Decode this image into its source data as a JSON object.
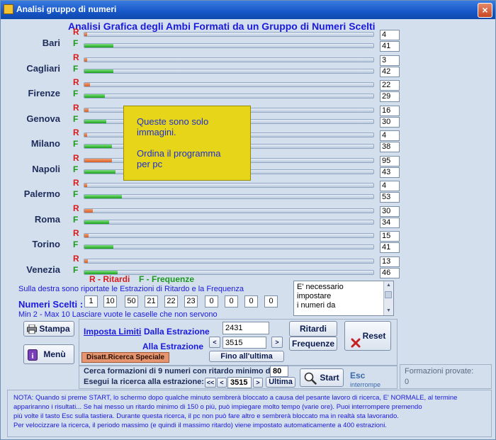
{
  "window": {
    "title": "Analisi gruppo di numeri",
    "close_label": "×"
  },
  "heading": "Analisi Grafica degli Ambi Formati da un Gruppo di Numeri Scelti",
  "row_labels": {
    "r": "R",
    "f": "F"
  },
  "cities": [
    {
      "name": "Bari",
      "ritardo": "4",
      "frequenza": "41",
      "r_pct": 0.004,
      "f_pct": 0.1
    },
    {
      "name": "Cagliari",
      "ritardo": "3",
      "frequenza": "42",
      "r_pct": 0.003,
      "f_pct": 0.1
    },
    {
      "name": "Firenze",
      "ritardo": "22",
      "frequenza": "29",
      "r_pct": 0.02,
      "f_pct": 0.07
    },
    {
      "name": "Genova",
      "ritardo": "16",
      "frequenza": "30",
      "r_pct": 0.015,
      "f_pct": 0.075
    },
    {
      "name": "Milano",
      "ritardo": "4",
      "frequenza": "38",
      "r_pct": 0.004,
      "f_pct": 0.095
    },
    {
      "name": "Napoli",
      "ritardo": "95",
      "frequenza": "43",
      "r_pct": 0.095,
      "f_pct": 0.107
    },
    {
      "name": "Palermo",
      "ritardo": "4",
      "frequenza": "53",
      "r_pct": 0.004,
      "f_pct": 0.13
    },
    {
      "name": "Roma",
      "ritardo": "30",
      "frequenza": "34",
      "r_pct": 0.03,
      "f_pct": 0.085
    },
    {
      "name": "Torino",
      "ritardo": "15",
      "frequenza": "41",
      "r_pct": 0.015,
      "f_pct": 0.1
    },
    {
      "name": "Venezia",
      "ritardo": "13",
      "frequenza": "46",
      "r_pct": 0.013,
      "f_pct": 0.115
    }
  ],
  "legend": {
    "ritardi": "R - Ritardi",
    "frequenze": "F - Frequenze"
  },
  "info_line": "Sulla destra sono riportate le Estrazioni di Ritardo e la Frequenza",
  "memo": {
    "lines": [
      "E' necessario",
      "impostare",
      "i numeri da"
    ]
  },
  "numeri_scelti": {
    "label": "Numeri Scelti :",
    "values": [
      "1",
      "10",
      "50",
      "21",
      "22",
      "23",
      "0",
      "0",
      "0",
      "0"
    ]
  },
  "minmax_hint": "Min 2 - Max 10 Lasciare vuote le caselle che non servono",
  "buttons": {
    "stampa": "Stampa",
    "menu": "Menù",
    "ritardi": "Ritardi",
    "frequenze": "Frequenze",
    "reset": "Reset",
    "fino_ultima": "Fino all'ultima",
    "start": "Start",
    "ultima": "Ultima"
  },
  "limiti": {
    "imposta_link": "Imposta Limiti",
    "dalla_label": "Dalla Estrazione",
    "dalla_value": "2431",
    "alla_label": "Alla Estrazione",
    "alla_value": "3515",
    "prev_label": "<",
    "next_label": ">"
  },
  "disatt_label": "Disatt.Ricerca Speciale",
  "cerca": {
    "label": "Cerca formazioni di 9 numeri con  ritardo minimo di:",
    "ritardo_value": "80",
    "esegui_label": "Esegui la ricerca alla estrazione:",
    "estrazione_value": "3515",
    "first_label": "<<",
    "prev_label": "<",
    "next_label": ">"
  },
  "esc": {
    "title": "Esc",
    "subtitle": "interrompe"
  },
  "formazioni": {
    "label": "Formazioni provate:",
    "value": "0"
  },
  "notes": [
    "NOTA: Quando si preme START, lo schermo dopo qualche minuto  sembrerà  bloccato a causa del pesante lavoro di ricerca, E' NORMALE, al termine",
    "appariranno  i risultati...    Se hai messo un ritardo minimo di 150 o più, può impiegare molto tempo (varie ore). Puoi interrompere premendo",
    "più volte il tasto Esc sulla tastiera.        Durante questa ricerca, il pc non può fare altro e sembrerà bloccato ma in realtà sta lavorando.",
    "Per velocizzare la ricerca, il periodo massimo (e quindi il massimo ritardo) viene impostato automaticamente a 400 estrazioni."
  ],
  "overlay": {
    "line1": "Queste sono solo",
    "line2": "immagini.",
    "line3": "Ordina il programma",
    "line4": "per pc"
  },
  "colors": {
    "title_bar": "#1656c8",
    "ritardo_bar": "#d85d23",
    "frequenza_bar": "#1c9f1c",
    "overlay": "#e6d519",
    "reset_icon": "#c42020"
  }
}
